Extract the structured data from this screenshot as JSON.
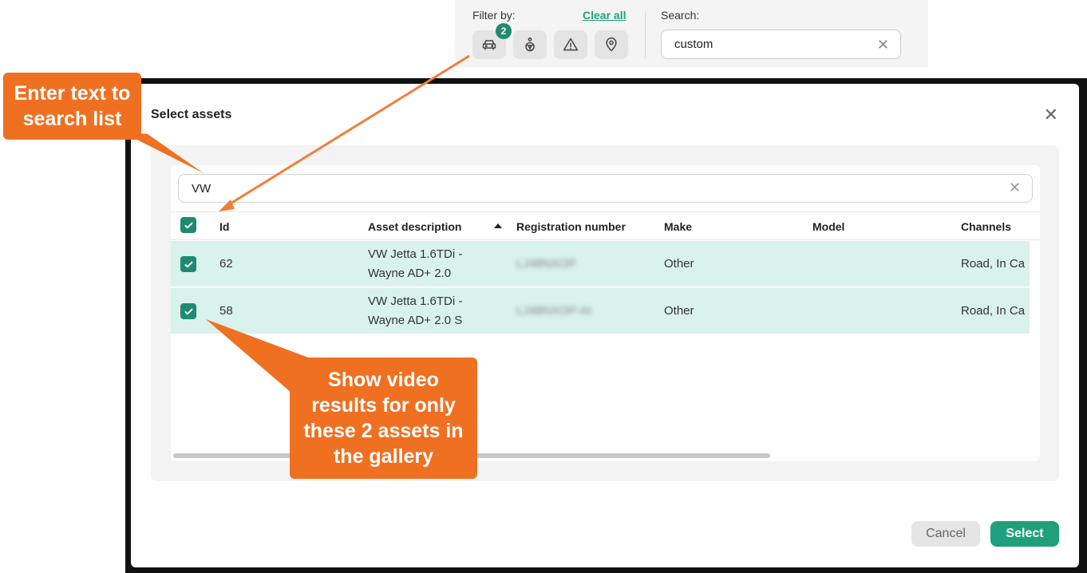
{
  "filter_bar": {
    "filter_label": "Filter by:",
    "clear_all": "Clear all",
    "badge_count": "2",
    "search_label": "Search:",
    "search_value": "custom",
    "icons": [
      "car-icon",
      "driver-icon",
      "warning-icon",
      "location-pin-icon"
    ]
  },
  "modal": {
    "title": "Select assets",
    "list_search_value": "VW",
    "columns": [
      "Id",
      "Asset description",
      "Registration number",
      "Make",
      "Model",
      "Channels"
    ],
    "sorted_column": "Asset description",
    "rows": [
      {
        "id": "62",
        "desc_line1": "VW Jetta 1.6TDi -",
        "desc_line2": "Wayne AD+ 2.0",
        "registration": "LJ48NXOP",
        "make": "Other",
        "model": "",
        "channels": "Road, In Ca",
        "checked": true
      },
      {
        "id": "58",
        "desc_line1": "VW Jetta 1.6TDi -",
        "desc_line2": "Wayne AD+ 2.0 S",
        "registration": "LJ48NXOP-AI",
        "make": "Other",
        "model": "",
        "channels": "Road, In Ca",
        "checked": true
      }
    ],
    "cancel_label": "Cancel",
    "select_label": "Select"
  },
  "callouts": {
    "search_line1": "Enter text to",
    "search_line2": "search list",
    "result_line1": "Show video",
    "result_line2": "results for only",
    "result_line3": "these 2 assets in",
    "result_line4": "the gallery"
  },
  "colors": {
    "accent": "#1f9f7c",
    "checkbox": "#1f8a70",
    "row_selected": "#d9f2ec",
    "callout": "#f07021"
  }
}
